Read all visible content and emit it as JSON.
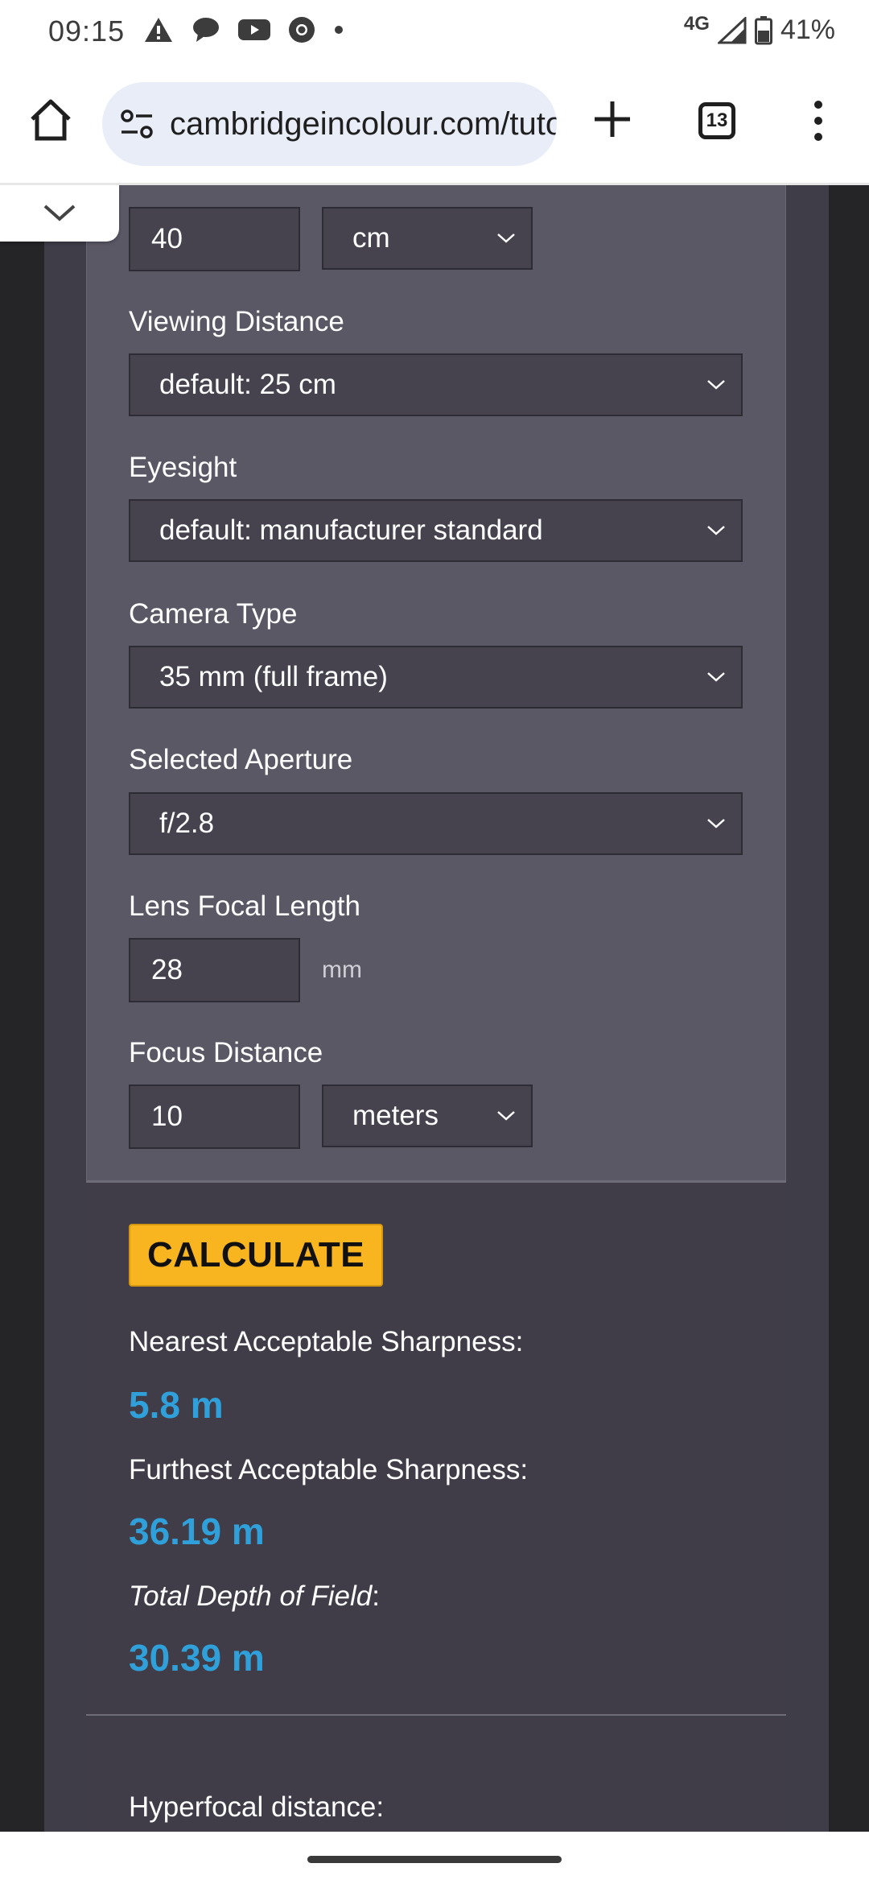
{
  "status_bar": {
    "time": "09:15",
    "notification_icons": [
      "warning-icon",
      "chat-icon",
      "youtube-icon",
      "chrome-icon",
      "dot-icon"
    ],
    "network": "4G",
    "battery": "41%"
  },
  "browser": {
    "url": "cambridgeincolour.com/tutorials/dof-calculator.htm",
    "tab_count": "13"
  },
  "form": {
    "print_width": {
      "value": "40",
      "unit": "cm"
    },
    "viewing_distance": {
      "label": "Viewing Distance",
      "value": "default: 25 cm"
    },
    "eyesight": {
      "label": "Eyesight",
      "value": "default: manufacturer standard"
    },
    "camera_type": {
      "label": "Camera Type",
      "value": "35 mm (full frame)"
    },
    "aperture": {
      "label": "Selected Aperture",
      "value": "f/2.8"
    },
    "focal_length": {
      "label": "Lens Focal Length",
      "value": "28",
      "unit": "mm"
    },
    "focus_distance": {
      "label": "Focus Distance",
      "value": "10",
      "unit": "meters"
    }
  },
  "calculate_label": "CALCULATE",
  "results": {
    "nearest_label": "Nearest Acceptable Sharpness:",
    "nearest_value": "5.8 m",
    "furthest_label": "Furthest Acceptable Sharpness:",
    "furthest_value": "36.19 m",
    "total_label": "Total Depth of Field",
    "total_value": "30.39 m",
    "hyperfocal_label": "Hyperfocal distance:"
  },
  "colors": {
    "accent_button": "#f8b520",
    "result_value": "#2fa0da",
    "panel": "#5b5866",
    "field": "#46434f"
  }
}
